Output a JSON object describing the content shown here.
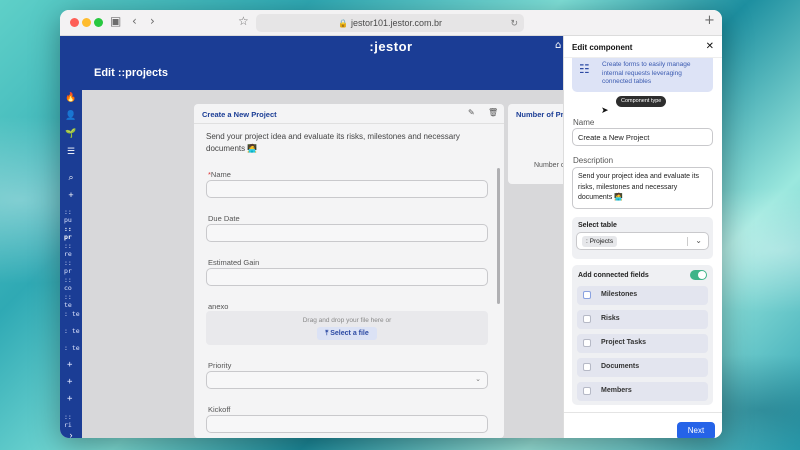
{
  "browser": {
    "url": "jestor101.jestor.com.br"
  },
  "app": {
    "brand": ":jestor",
    "page_title": "Edit ::projects"
  },
  "sidebar": {
    "items": [
      {
        "label": ":: pu"
      },
      {
        "label": ":: pr"
      },
      {
        "label": ":: re"
      },
      {
        "label": ":: pr"
      },
      {
        "label": ":: co"
      },
      {
        "label": ":: te"
      },
      {
        "label": ": te"
      },
      {
        "label": ": te"
      },
      {
        "label": ": te"
      },
      {
        "label": "+"
      },
      {
        "label": "+"
      },
      {
        "label": "+"
      },
      {
        "label": ":: ri"
      }
    ]
  },
  "form_card": {
    "title": "Create a New Project",
    "description": "Send your project idea and evaluate its risks, milestones and necessary documents 🧑‍💻",
    "fields": [
      {
        "label": "Name",
        "required": true
      },
      {
        "label": "Due Date"
      },
      {
        "label": "Estimated Gain"
      },
      {
        "label": "anexo"
      },
      {
        "label": "Priority"
      },
      {
        "label": "Kickoff"
      }
    ],
    "dropzone_text": "Drag and drop your file here or",
    "dropzone_button": "Select a file"
  },
  "metric_card": {
    "title": "Number of Pr",
    "subtitle": "Number o"
  },
  "panel": {
    "title": "Edit component",
    "info_text": "Create forms to easily manage internal requests leveraging connected tables",
    "tooltip": "Component type",
    "name_label": "Name",
    "name_value": "Create a New Project",
    "description_label": "Description",
    "description_value": "Send your project idea and evaluate its risks, milestones and necessary documents 🧑‍💻",
    "select_table_label": "Select table",
    "select_table_value": ": Projects",
    "connected_label": "Add connected fields",
    "connected_fields": [
      {
        "label": "Milestones"
      },
      {
        "label": "Risks"
      },
      {
        "label": "Project Tasks"
      },
      {
        "label": "Documents"
      },
      {
        "label": "Members"
      }
    ],
    "next_label": "Next"
  }
}
